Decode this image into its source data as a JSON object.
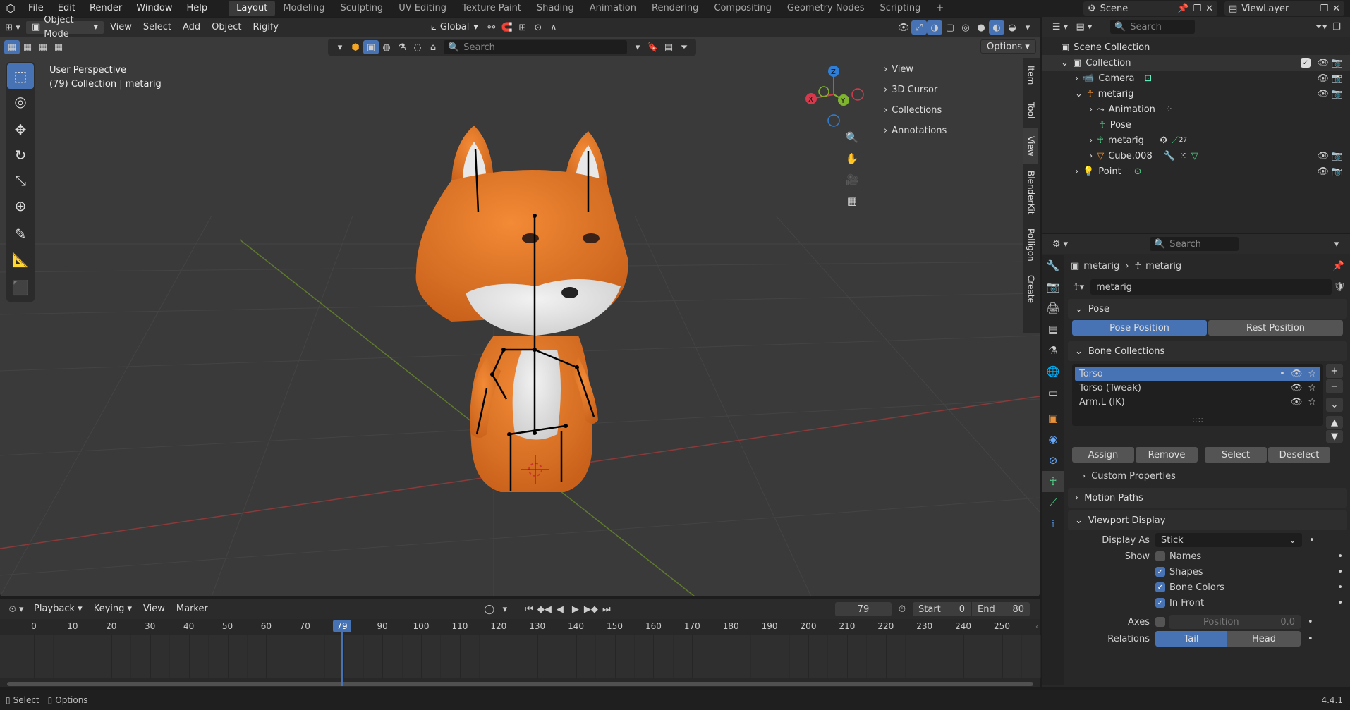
{
  "menu": {
    "items": [
      "File",
      "Edit",
      "Render",
      "Window",
      "Help"
    ],
    "workspaces": [
      "Layout",
      "Modeling",
      "Sculpting",
      "UV Editing",
      "Texture Paint",
      "Shading",
      "Animation",
      "Rendering",
      "Compositing",
      "Geometry Nodes",
      "Scripting"
    ],
    "active_workspace": "Layout",
    "add_workspace": "+",
    "scene": "Scene",
    "view_layer": "ViewLayer"
  },
  "viewport_header": {
    "mode": "Object Mode",
    "menus": [
      "View",
      "Select",
      "Add",
      "Object",
      "Rigify"
    ],
    "orientation": "Global",
    "search_placeholder": "Search",
    "options": "Options"
  },
  "viewport": {
    "perspective": "User Perspective",
    "collection_info": "(79) Collection | metarig",
    "gizmo": {
      "z": "Z",
      "y": "Y",
      "x": "X"
    }
  },
  "npanel": {
    "items": [
      "View",
      "3D Cursor",
      "Collections",
      "Annotations"
    ],
    "tabs": [
      "Item",
      "Tool",
      "View",
      "BlenderKit",
      "Polligon",
      "Create"
    ]
  },
  "outliner": {
    "search_placeholder": "Search",
    "rows": [
      {
        "label": "Scene Collection",
        "indent": 0
      },
      {
        "label": "Collection",
        "indent": 1
      },
      {
        "label": "Camera",
        "indent": 2
      },
      {
        "label": "metarig",
        "indent": 2
      },
      {
        "label": "Animation",
        "indent": 3
      },
      {
        "label": "Pose",
        "indent": 3
      },
      {
        "label": "metarig",
        "indent": 3
      },
      {
        "label": "Cube.008",
        "indent": 3
      },
      {
        "label": "Point",
        "indent": 2
      }
    ],
    "bone_count": "27"
  },
  "properties": {
    "search_placeholder": "Search",
    "breadcrumb": [
      "metarig",
      "metarig"
    ],
    "data_name": "metarig",
    "pose_panel": "Pose",
    "pose_position": "Pose Position",
    "rest_position": "Rest Position",
    "bone_collections_panel": "Bone Collections",
    "bone_collections": [
      "Torso",
      "Torso (Tweak)",
      "Arm.L (IK)"
    ],
    "assign": "Assign",
    "remove": "Remove",
    "select": "Select",
    "deselect": "Deselect",
    "custom_properties": "Custom Properties",
    "motion_paths": "Motion Paths",
    "viewport_display": "Viewport Display",
    "display_as_label": "Display As",
    "display_as_value": "Stick",
    "show_label": "Show",
    "show_options": [
      {
        "label": "Names",
        "checked": false
      },
      {
        "label": "Shapes",
        "checked": true
      },
      {
        "label": "Bone Colors",
        "checked": true
      },
      {
        "label": "In Front",
        "checked": true
      }
    ],
    "axes_label": "Axes",
    "axes_position_label": "Position",
    "axes_position_value": "0.0",
    "relations_label": "Relations",
    "relations_tail": "Tail",
    "relations_head": "Head"
  },
  "timeline": {
    "menus": [
      "Playback",
      "Keying",
      "View",
      "Marker"
    ],
    "current_frame": "79",
    "start_label": "Start",
    "start_value": "0",
    "end_label": "End",
    "end_value": "80",
    "ruler": [
      "0",
      "10",
      "20",
      "30",
      "40",
      "50",
      "60",
      "70",
      "79",
      "90",
      "100",
      "110",
      "120",
      "130",
      "140",
      "150",
      "160",
      "170",
      "180",
      "190",
      "200",
      "210",
      "220",
      "230",
      "240",
      "250"
    ]
  },
  "status": {
    "select": "Select",
    "options": "Options",
    "version": "4.4.1"
  },
  "colors": {
    "accent": "#4772b3",
    "fox_orange": "#e2741f",
    "fox_white": "#e6e6e6"
  }
}
